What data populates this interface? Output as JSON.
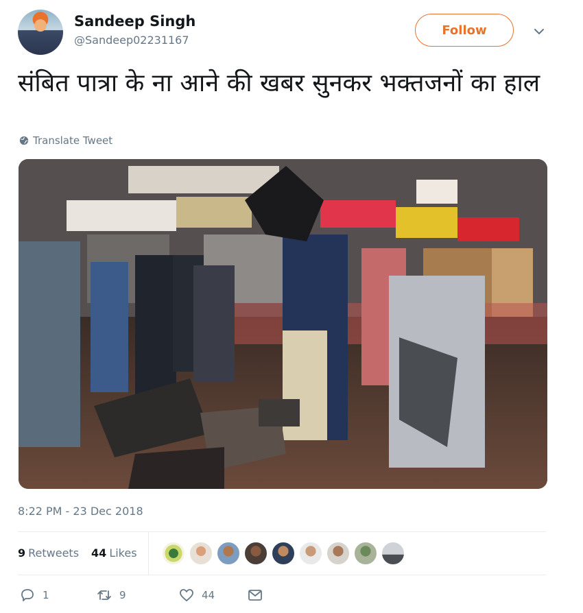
{
  "author": {
    "name": "Sandeep Singh",
    "handle": "@Sandeep02231167"
  },
  "follow_label": "Follow",
  "tweet": {
    "text": "संबित पात्रा के ना आने की खबर सुनकर भक्तजनों का हाल",
    "translate_label": "Translate Tweet",
    "timestamp": "8:22 PM - 23 Dec 2018"
  },
  "stats": {
    "retweets_count": "9",
    "retweets_label": "Retweets",
    "likes_count": "44",
    "likes_label": "Likes"
  },
  "likers_count_shown": 9,
  "actions": {
    "reply_count": "1",
    "retweet_count": "9",
    "like_count": "44"
  },
  "colors": {
    "accent": "#e8732c",
    "muted": "#657786",
    "text": "#14171a",
    "border": "#e6ecf0"
  },
  "icons": {
    "header": [
      "chevron-down-icon"
    ],
    "translate": "globe-icon",
    "actions": [
      "reply-icon",
      "retweet-icon",
      "heart-icon",
      "message-icon"
    ]
  }
}
